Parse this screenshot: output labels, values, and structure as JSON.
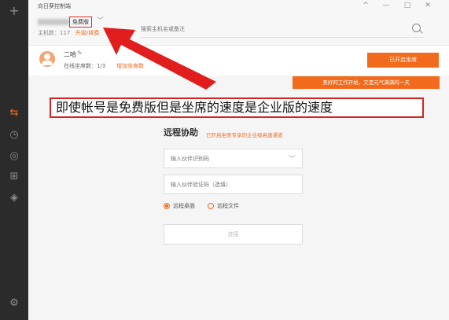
{
  "app": {
    "title": "向日葵控制端"
  },
  "window_controls": {
    "collapse": "^",
    "minimize": "—",
    "maximize": "□",
    "close": "✕"
  },
  "account": {
    "plan_badge": "免费版",
    "dropdown_icon": "﹀",
    "host_count": "主机数：117",
    "upgrade_link": "升级/续费"
  },
  "search": {
    "placeholder": "搜索主机名或备注",
    "icon": "search-icon"
  },
  "profile": {
    "name": "二哈",
    "edit_icon": "✎",
    "online_seats": "在线坐席数：1/3",
    "add_seats_link": "增加坐席数",
    "open_seat_button": "已开启坐席"
  },
  "banner": {
    "text": "美好的工作开始，又是元气满满的一天"
  },
  "annotation": {
    "text": "即使帐号是免费版但是坐席的速度是企业版的速度"
  },
  "remote": {
    "title": "远程协助",
    "subtitle": "已开启坐席专享的企业级高速通道",
    "partner_id_placeholder": "输入伙伴识别码",
    "partner_code_placeholder": "输入伙伴验证码（选填）",
    "mode_desktop": "远程桌面",
    "mode_file": "远程文件",
    "selected_mode": "远程桌面",
    "connect_button": "连接"
  },
  "sidebar": {
    "icons": [
      "add-icon",
      "remote-icon",
      "history-icon",
      "user-icon",
      "device-icon",
      "discover-icon",
      "settings-icon"
    ],
    "active": "remote-icon"
  },
  "colors": {
    "accent": "#f26b1d",
    "sidebar": "#2b2b2b",
    "annotation_red": "#d32323"
  }
}
